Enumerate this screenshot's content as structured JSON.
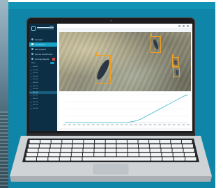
{
  "sidebar": {
    "nav": [
      {
        "label": "Overview",
        "active": false
      },
      {
        "label": "Live Stream",
        "active": true
      },
      {
        "label": "Fish Analytics",
        "active": false
      },
      {
        "label": "Species Identification",
        "active": false
      },
      {
        "label": "Anomaly Reports",
        "active": false,
        "badge": true
      }
    ],
    "section_label": "Sites",
    "sites": [
      "Site 01",
      "Site 02",
      "Site 03",
      "Site 04",
      "Site 05",
      "Site 06",
      "Site 07",
      "Site 08",
      "Site 09",
      "Site 10",
      "Site 11",
      "Site 12",
      "Site 13",
      "Site 14"
    ],
    "selected_site_index": 8
  },
  "topbar": {
    "left_text": "",
    "right_text": ""
  },
  "detections": [
    {
      "label": ""
    },
    {
      "label": ""
    },
    {
      "label": ""
    },
    {
      "label": ""
    }
  ],
  "chart_data": {
    "type": "line",
    "series": [
      {
        "values": [
          0,
          0,
          0,
          0,
          0,
          0,
          0,
          0,
          0,
          0,
          0,
          0,
          0,
          0,
          1,
          2,
          4,
          7,
          10,
          13,
          16,
          19,
          22,
          25,
          28,
          31,
          33
        ]
      }
    ],
    "x_tick_count": 27,
    "grid": true
  },
  "colors": {
    "panel_background": "#0f86a8",
    "sidebar": "#0c2f45",
    "accent": "#17a2c8",
    "detection_box": "#f2a01f",
    "line": "#38b7c8"
  }
}
